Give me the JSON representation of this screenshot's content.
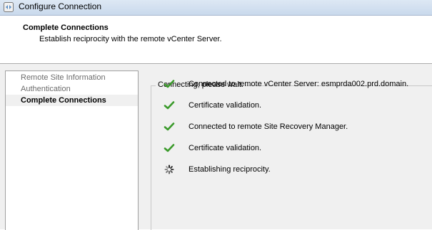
{
  "window": {
    "title": "Configure Connection"
  },
  "header": {
    "title": "Complete Connections",
    "subtitle": "Establish reciprocity with the remote vCenter Server."
  },
  "nav": {
    "items": [
      {
        "label": "Remote Site Information",
        "active": false
      },
      {
        "label": "Authentication",
        "active": false
      },
      {
        "label": "Complete Connections",
        "active": true
      }
    ]
  },
  "progress": {
    "group_label": "Connecting, please wait.",
    "steps": [
      {
        "icon": "check-icon",
        "text": "Connected to remote vCenter Server: esmprda002.prd.domain."
      },
      {
        "icon": "check-icon",
        "text": "Certificate validation."
      },
      {
        "icon": "check-icon",
        "text": "Connected  to remote Site Recovery Manager."
      },
      {
        "icon": "check-icon",
        "text": "Certificate validation."
      },
      {
        "icon": "spinner-icon",
        "text": "Establishing reciprocity."
      }
    ]
  },
  "colors": {
    "check": "#3a9a2a",
    "titlebar": "#c9d9ec"
  }
}
